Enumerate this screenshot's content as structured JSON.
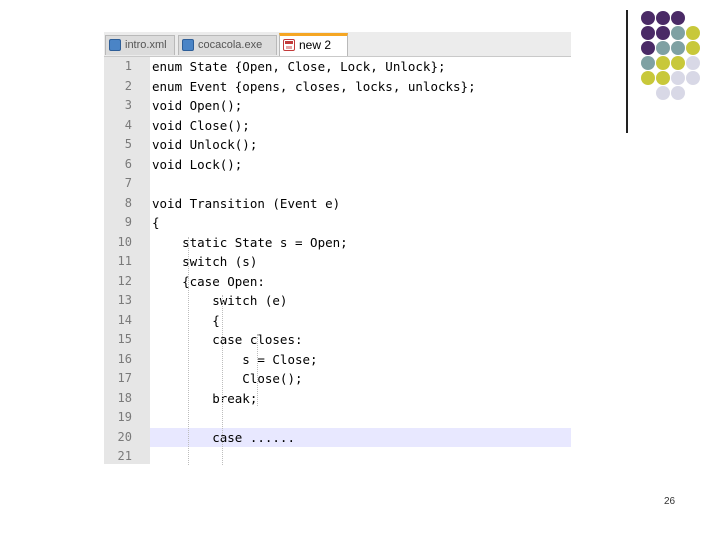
{
  "tabs": [
    {
      "label": "intro.xml",
      "icon": "save-file-icon",
      "active": false
    },
    {
      "label": "cocacola.exe",
      "icon": "save-file-icon",
      "active": false
    },
    {
      "label": "new 2",
      "icon": "unsaved-file-icon",
      "active": true
    }
  ],
  "code_lines": [
    {
      "num": "1",
      "text": "enum State {Open, Close, Lock, Unlock};"
    },
    {
      "num": "2",
      "text": "enum Event {opens, closes, locks, unlocks};"
    },
    {
      "num": "3",
      "text": "void Open();"
    },
    {
      "num": "4",
      "text": "void Close();"
    },
    {
      "num": "5",
      "text": "void Unlock();"
    },
    {
      "num": "6",
      "text": "void Lock();"
    },
    {
      "num": "7",
      "text": ""
    },
    {
      "num": "8",
      "text": "void Transition (Event e)"
    },
    {
      "num": "9",
      "text": "{"
    },
    {
      "num": "10",
      "text": "    static State s = Open;"
    },
    {
      "num": "11",
      "text": "    switch (s)"
    },
    {
      "num": "12",
      "text": "    {case Open:"
    },
    {
      "num": "13",
      "text": "        switch (e)"
    },
    {
      "num": "14",
      "text": "        {"
    },
    {
      "num": "15",
      "text": "        case closes:"
    },
    {
      "num": "16",
      "text": "            s = Close;"
    },
    {
      "num": "17",
      "text": "            Close();"
    },
    {
      "num": "18",
      "text": "        break;"
    },
    {
      "num": "19",
      "text": ""
    },
    {
      "num": "20",
      "text": "        case ......"
    },
    {
      "num": "21",
      "text": ""
    }
  ],
  "highlighted_line": "20",
  "page_number": "26",
  "colors": {
    "dot_purple": "#4a2a66",
    "dot_teal": "#7fa1a3",
    "dot_yellow": "#c8c83a",
    "dot_lavender": "#d8d8e6",
    "active_tab_accent": "#f5a623",
    "line_highlight": "#e8e8ff"
  }
}
